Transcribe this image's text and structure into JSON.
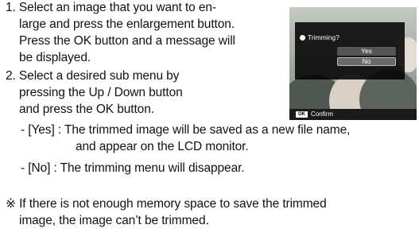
{
  "steps": [
    {
      "lines": [
        "1. Select an image that you want to en-",
        "large and press the enlargement button.",
        "Press the OK button and a message will",
        "be displayed."
      ]
    },
    {
      "lines": [
        "2. Select a desired sub menu by",
        "pressing the Up / Down button",
        "and press the OK button."
      ]
    }
  ],
  "options": [
    {
      "lines": [
        "- [Yes]  : The trimmed image will be saved as a new file name,",
        "and appear on the LCD monitor."
      ]
    },
    {
      "lines": [
        "- [No]   : The trimming menu will disappear."
      ]
    }
  ],
  "note": {
    "lines": [
      "※ If there is not enough memory space to save the trimmed",
      "image, the image can’t be trimmed."
    ]
  },
  "screen": {
    "dialog_title": "Trimming?",
    "option_yes": "Yes",
    "option_no": "No",
    "ok_key": "OK",
    "confirm_label": "Confirm",
    "colors": {
      "dialog_bg": "#000000",
      "selected_option": "#555555",
      "bottom_bar": "#1a1a1a"
    }
  }
}
